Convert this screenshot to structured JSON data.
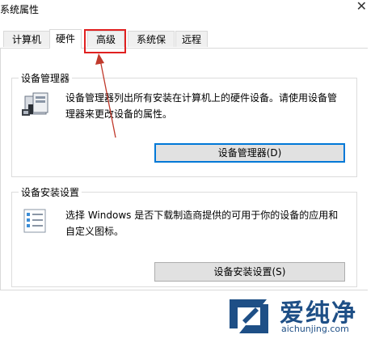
{
  "window": {
    "title": "系统属性"
  },
  "tabs": [
    {
      "label": "计算机名"
    },
    {
      "label": "硬件"
    },
    {
      "label": "高级"
    },
    {
      "label": "系统保护"
    },
    {
      "label": "远程"
    }
  ],
  "device_manager": {
    "legend": "设备管理器",
    "description_line1": "设备管理器列出所有安装在计算机上的硬件设备。请使用设备管",
    "description_line2": "理器来更改设备的属性。",
    "button_label": "设备管理器(D)"
  },
  "device_install": {
    "legend": "设备安装设置",
    "description_line1": "选择 Windows 是否下载制造商提供的可用于你的设备的应用和",
    "description_line2": "自定义图标。",
    "button_label": "设备安装设置(S)"
  },
  "watermark": {
    "text": "爱纯净",
    "url": "aichunjing.com"
  },
  "colors": {
    "highlight": "#e02020",
    "focus": "#0078d7",
    "watermark": "#1e4f86"
  }
}
